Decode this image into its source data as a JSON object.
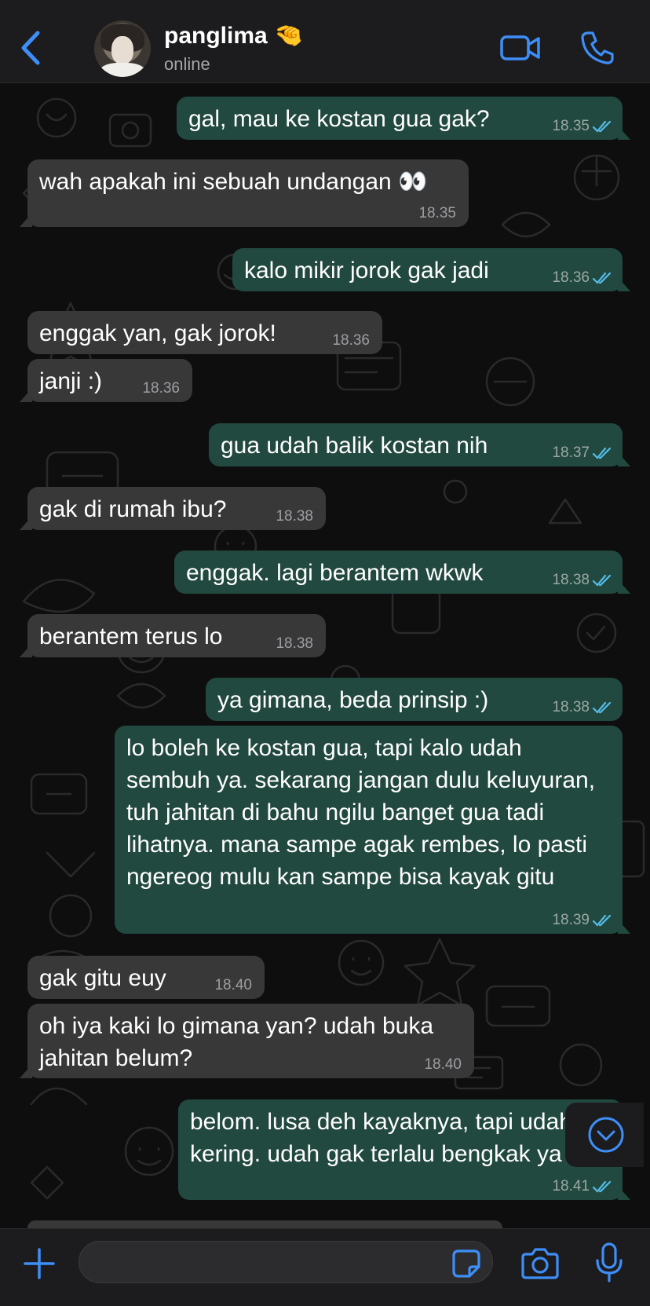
{
  "header": {
    "contact_name": "panglima 🤏",
    "status": "online"
  },
  "messages": [
    {
      "dir": "out",
      "text": "gal, mau ke kostan gua gak?",
      "time": "18.35",
      "read": true
    },
    {
      "dir": "in",
      "text": "wah apakah ini sebuah undangan 👀",
      "time": "18.35"
    },
    {
      "dir": "out",
      "text": "kalo mikir jorok gak jadi",
      "time": "18.36",
      "read": true
    },
    {
      "dir": "in",
      "text": "enggak yan, gak jorok!",
      "time": "18.36"
    },
    {
      "dir": "in",
      "text": "janji :)",
      "time": "18.36"
    },
    {
      "dir": "out",
      "text": "gua udah balik kostan nih",
      "time": "18.37",
      "read": true
    },
    {
      "dir": "in",
      "text": "gak di rumah ibu?",
      "time": "18.38"
    },
    {
      "dir": "out",
      "text": "enggak. lagi berantem wkwk",
      "time": "18.38",
      "read": true
    },
    {
      "dir": "in",
      "text": "berantem terus lo",
      "time": "18.38"
    },
    {
      "dir": "out",
      "text": "ya gimana, beda prinsip :)",
      "time": "18.38",
      "read": true
    },
    {
      "dir": "out",
      "text": "lo boleh ke kostan gua, tapi kalo udah sembuh ya. sekarang jangan dulu keluyuran, tuh jahitan di bahu ngilu banget gua tadi lihatnya. mana sampe agak rembes, lo pasti ngereog mulu kan sampe bisa kayak gitu",
      "time": "18.39",
      "read": true
    },
    {
      "dir": "in",
      "text": "gak gitu euy",
      "time": "18.40"
    },
    {
      "dir": "in",
      "text": "oh iya kaki lo gimana yan? udah buka jahitan belum?",
      "time": "18.40"
    },
    {
      "dir": "out",
      "text": "belom. lusa deh kayaknya, tapi udah kering. udah gak terlalu bengkak ya",
      "time": "18.41",
      "read": true
    }
  ],
  "composer": {
    "value": "",
    "placeholder": ""
  },
  "icons": {
    "back": "chevron-left-icon",
    "video": "video-camera-icon",
    "call": "phone-icon",
    "plus": "plus-icon",
    "sticker": "sticker-icon",
    "camera": "camera-icon",
    "mic": "microphone-icon",
    "scroll": "chevron-down-circle-icon"
  },
  "colors": {
    "accent": "#3e8ef7",
    "outgoing_bubble": "#22493f",
    "incoming_bubble": "#383839",
    "read_ticks": "#53bdeb"
  }
}
